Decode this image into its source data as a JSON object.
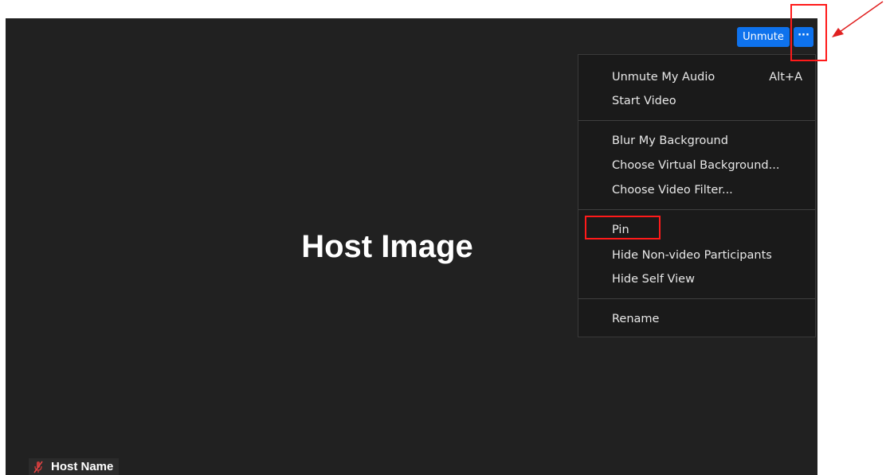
{
  "video": {
    "placeholder_text": "Host Image"
  },
  "toolbar": {
    "unmute_label": "Unmute",
    "more_label": "···"
  },
  "menu": {
    "items": [
      {
        "label": "Unmute My Audio",
        "shortcut": "Alt+A"
      },
      {
        "label": "Start Video"
      },
      {
        "label": "Blur My Background"
      },
      {
        "label": "Choose Virtual Background..."
      },
      {
        "label": "Choose Video Filter..."
      },
      {
        "label": "Pin"
      },
      {
        "label": "Hide Non-video Participants"
      },
      {
        "label": "Hide Self View"
      },
      {
        "label": "Rename"
      }
    ]
  },
  "participant": {
    "name": "Host Name",
    "mic_icon": "mic-muted-icon"
  },
  "annotations": {
    "highlight_color": "#ff1a1a",
    "arrow_color": "#e02020"
  },
  "colors": {
    "accent": "#0e72ed",
    "video_background": "#212121",
    "menu_background": "#1a1a1a"
  }
}
